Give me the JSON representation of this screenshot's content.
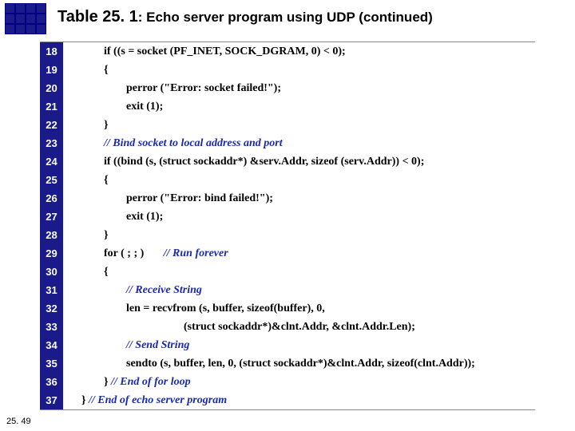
{
  "title": {
    "prefix": "Table 25. 1",
    "suffix": ": Echo server program using UDP (continued)"
  },
  "footer": "25. 49",
  "lines": [
    {
      "n": "18",
      "indent": "code ind1",
      "text": "if ((s = socket (PF_INET, SOCK_DGRAM, 0) < 0);"
    },
    {
      "n": "19",
      "indent": "code ind1",
      "text": "{"
    },
    {
      "n": "20",
      "indent": "code ind2",
      "text": "perror (\"Error: socket failed!\");"
    },
    {
      "n": "21",
      "indent": "code ind2",
      "text": "exit (1);"
    },
    {
      "n": "22",
      "indent": "code ind1",
      "text": "}"
    },
    {
      "n": "23",
      "indent": "code ind1 comment",
      "text": "// Bind socket to local address and port"
    },
    {
      "n": "24",
      "indent": "code ind1",
      "text": "if ((bind (s, (struct sockaddr*) &serv.Addr, sizeof (serv.Addr)) < 0);"
    },
    {
      "n": "25",
      "indent": "code ind1",
      "text": "{"
    },
    {
      "n": "26",
      "indent": "code ind2",
      "text": "perror (\"Error: bind failed!\");"
    },
    {
      "n": "27",
      "indent": "code ind2",
      "text": "exit (1);"
    },
    {
      "n": "28",
      "indent": "code ind1",
      "text": "}"
    },
    {
      "n": "29",
      "indent": "code ind1",
      "text": "for ( ; ; )       ",
      "comment_after": "// Run forever"
    },
    {
      "n": "30",
      "indent": "code ind1",
      "text": "{"
    },
    {
      "n": "31",
      "indent": "code ind2 comment",
      "text": "// Receive String"
    },
    {
      "n": "32",
      "indent": "code ind2",
      "text": "len = recvfrom (s, buffer, sizeof(buffer), 0,"
    },
    {
      "n": "33",
      "indent": "code cont",
      "text": "(struct sockaddr*)&clnt.Addr, &clnt.Addr.Len);"
    },
    {
      "n": "34",
      "indent": "code ind2 comment",
      "text": "// Send String"
    },
    {
      "n": "35",
      "indent": "code ind2",
      "text": "sendto (s, buffer, len, 0, (struct sockaddr*)&clnt.Addr, sizeof(clnt.Addr));"
    },
    {
      "n": "36",
      "indent": "code ind1",
      "text": "} ",
      "comment_after": "// End of for loop"
    },
    {
      "n": "37",
      "indent": "code",
      "text": "} ",
      "comment_after": "// End of echo server program"
    }
  ]
}
